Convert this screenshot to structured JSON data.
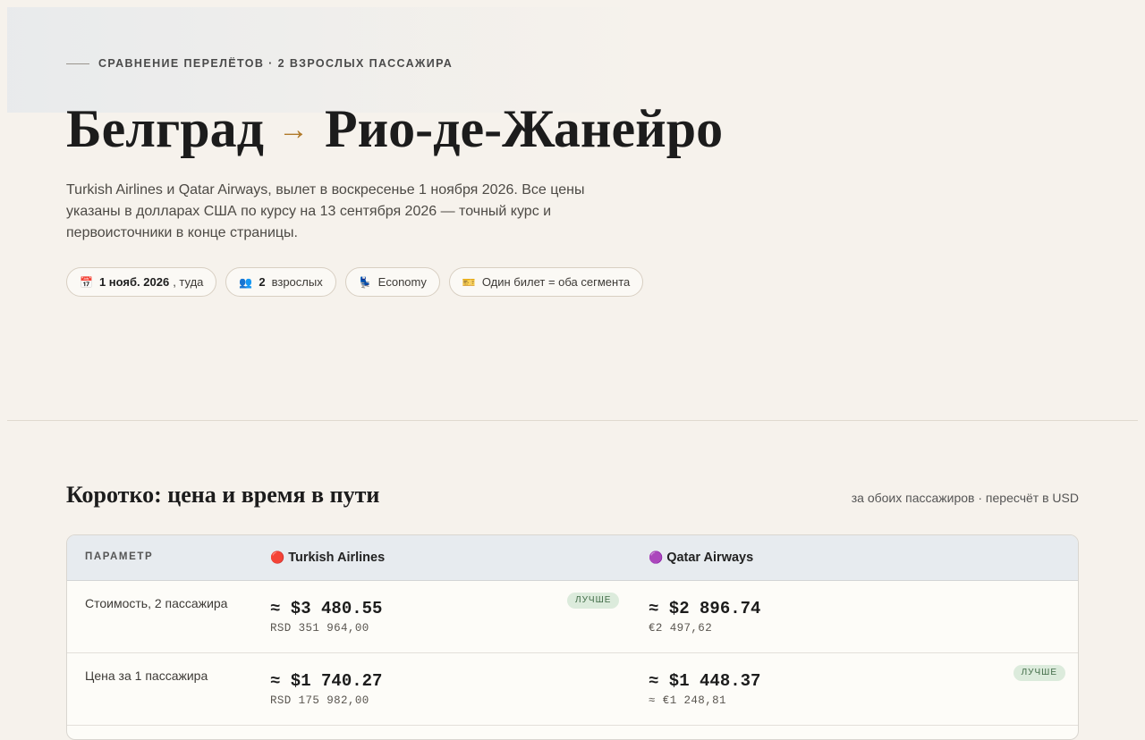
{
  "hero": {
    "eyebrow": "СРАВНЕНИЕ ПЕРЕЛЁТОВ · 2 ВЗРОСЛЫХ ПАССАЖИРА",
    "origin": "Белград",
    "arrow": "→",
    "destination": "Рио-де-Жанейро",
    "subtitle": "Turkish Airlines и Qatar Airways, вылет в воскресенье 1 ноября 2026. Все цены указаны в долларах США по курсу на 13 сентября 2026 — точный курс и первоисточники в конце страницы."
  },
  "chips": [
    {
      "icon": "📅",
      "icon_name": "calendar-icon",
      "strong": "1 нояб. 2026",
      "text": ", туда"
    },
    {
      "icon": "👥",
      "icon_name": "people-icon",
      "strong": "2",
      "text": "взрослых"
    },
    {
      "icon": "💺",
      "icon_name": "seat-icon",
      "text": "Economy"
    },
    {
      "icon": "🎫",
      "icon_name": "ticket-icon",
      "text": "Один билет = оба сегмента"
    }
  ],
  "summary": {
    "title": "Коротко: цена и время в пути",
    "note": "за обоих пассажиров · пересчёт в USD"
  },
  "table": {
    "param_header": "ПАРАМЕТР",
    "airlines": [
      {
        "dot": "🔴",
        "name": "Turkish Airlines",
        "color": "#e0322b"
      },
      {
        "dot": "🟣",
        "name": "Qatar Airways",
        "color": "#7b3fa0"
      }
    ],
    "rows": [
      {
        "label": "Стоимость, 2 пассажира",
        "a": {
          "price": "≈ $3 480.55",
          "sub": "RSD 351 964,00",
          "badge": "ЛУЧШЕ"
        },
        "b": {
          "price": "≈ $2 896.74",
          "sub": "€2 497,62"
        }
      },
      {
        "label": "Цена за 1 пассажира",
        "a": {
          "price": "≈ $1 740.27",
          "sub": "RSD 175 982,00"
        },
        "b": {
          "price": "≈ $1 448.37",
          "sub": "≈ €1 248,81",
          "badge": "ЛУЧШЕ"
        }
      }
    ]
  },
  "colors": {
    "background": "#f6f2ec",
    "accent_arrow": "#b07a2a",
    "badge_bg": "#dcebdc",
    "badge_text": "#3f6a45",
    "table_header_bg": "#e7ebef"
  }
}
